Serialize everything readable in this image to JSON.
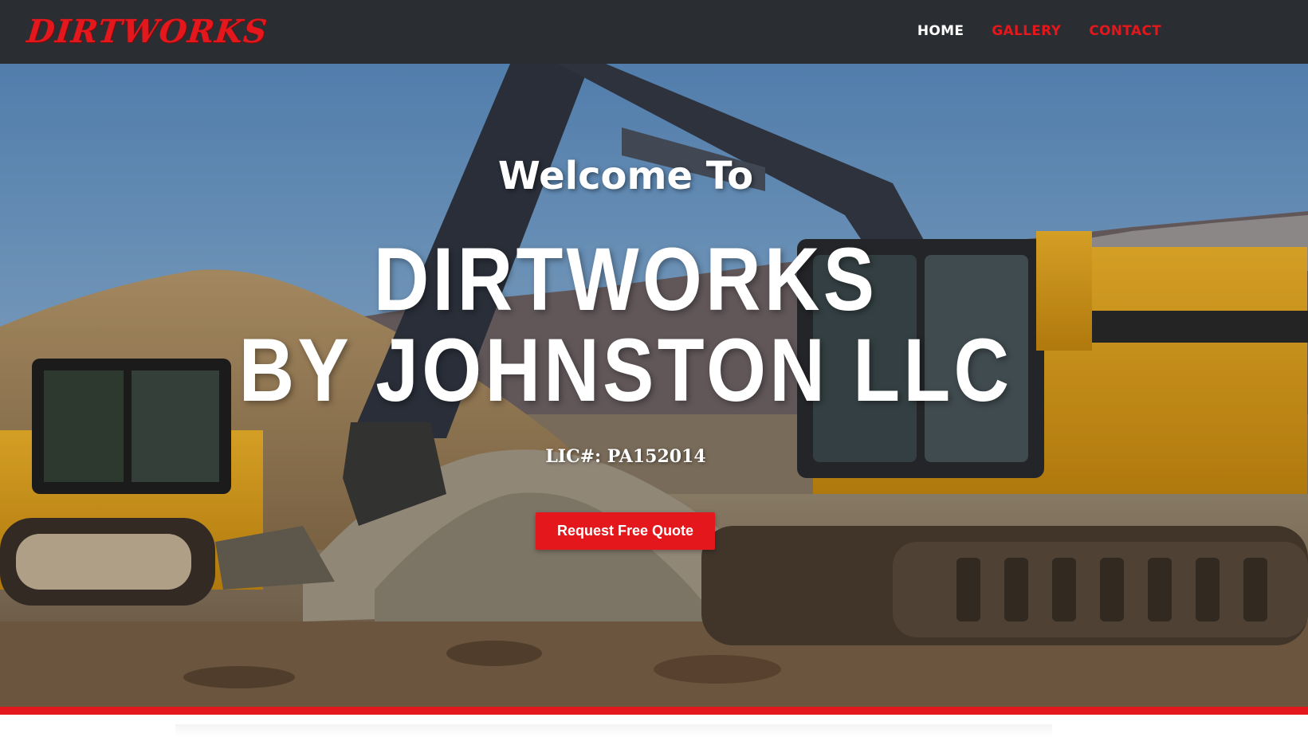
{
  "header": {
    "brand": "DIRTWORKS",
    "nav": [
      {
        "label": "HOME",
        "active": true
      },
      {
        "label": "GALLERY",
        "active": false
      },
      {
        "label": "CONTACT",
        "active": false
      }
    ]
  },
  "hero": {
    "welcome": "Welcome To",
    "title_line1": "DIRTWORKS",
    "title_line2": "BY JOHNSTON LLC",
    "license": "LIC#:  PA152014",
    "cta_label": "Request Free Quote",
    "background_image": "excavator-and-skid-steer-photo"
  },
  "colors": {
    "accent": "#e3171c",
    "header_bg": "#2a2d31",
    "text_light": "#ffffff"
  }
}
